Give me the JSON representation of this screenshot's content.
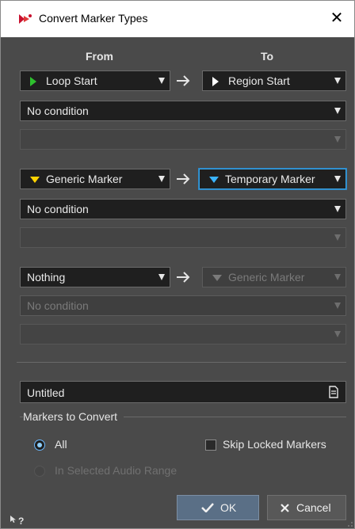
{
  "window": {
    "title": "Convert Marker Types",
    "close_glyph": "✕"
  },
  "columns": {
    "from": "From",
    "to": "To"
  },
  "rule1": {
    "from": {
      "label": "Loop Start",
      "icon": "loop-start-marker-icon",
      "icon_color": "#2ec02e"
    },
    "to": {
      "label": "Region Start",
      "icon": "region-start-marker-icon",
      "icon_color": "#ffffff"
    },
    "condition": "No condition",
    "condition_value": ""
  },
  "rule2": {
    "from": {
      "label": "Generic Marker",
      "icon": "generic-marker-icon",
      "icon_color": "#ffd400"
    },
    "to": {
      "label": "Temporary Marker",
      "icon": "temporary-marker-icon",
      "icon_color": "#3ab4ff"
    },
    "condition": "No condition",
    "condition_value": ""
  },
  "rule3": {
    "from": {
      "label": "Nothing"
    },
    "to": {
      "label": "Generic Marker",
      "icon": "generic-marker-icon",
      "icon_color": "#7a7a7a"
    },
    "condition": "No condition",
    "condition_value": ""
  },
  "name_field": {
    "value": "Untitled"
  },
  "markers_to_convert": {
    "label": "Markers to Convert",
    "all": "All",
    "selected_range": "In Selected Audio Range",
    "skip_locked": "Skip Locked Markers"
  },
  "buttons": {
    "ok": "OK",
    "cancel": "Cancel"
  },
  "help": "?",
  "colors": {
    "accent": "#39a0e0",
    "background": "#4a4a4a",
    "field": "#1f1f1f"
  }
}
